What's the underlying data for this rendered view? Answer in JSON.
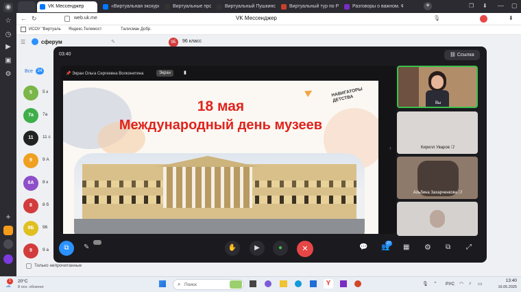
{
  "browser": {
    "tabs": [
      {
        "label": "VK Мессенджер",
        "color": "#0077ff",
        "active": true
      },
      {
        "label": "«Виртуальная экскурс",
        "color": "#0077ff"
      },
      {
        "label": "Виртуальные прогулки",
        "color": "#333333"
      },
      {
        "label": "Виртуальный Пушкинс",
        "color": "#333333"
      },
      {
        "label": "Виртуальный тур по Ру",
        "color": "#c9412b"
      },
      {
        "label": "Разговоры о важном. Ф",
        "color": "#7a2cc4"
      }
    ],
    "url": "web.uk.me",
    "page_title": "VK Мессенджер",
    "bookmarks": [
      "ИСОУ \"Виртуаль",
      "Яндекс.Телемост",
      "Талисман Добр."
    ]
  },
  "messenger": {
    "app_name": "сферум",
    "filter_all": "Все",
    "filter_count": "24",
    "chat_header": "96 класс",
    "chats": [
      {
        "initial": "5",
        "label": "5 к",
        "color": "#7ab648"
      },
      {
        "initial": "7а",
        "label": "7а",
        "color": "#3fae49"
      },
      {
        "initial": "11",
        "label": "11 с",
        "color": "#222222"
      },
      {
        "initial": "9",
        "label": "9 А",
        "color": "#f0a020"
      },
      {
        "initial": "8А",
        "label": "8 к",
        "color": "#8e4fc9"
      },
      {
        "initial": "8",
        "label": "8 б",
        "color": "#d23c3c"
      },
      {
        "initial": "9Б",
        "label": "96",
        "color": "#e0c020"
      },
      {
        "initial": "9",
        "label": "9 а",
        "color": "#d23c3c"
      }
    ],
    "unread_only": "Только непрочитанные"
  },
  "call": {
    "timer": "03:40",
    "link_label": "Ссылка",
    "screen_owner": "Экран Ольга Сергеевна Волконитина",
    "screen_tag": "Экран",
    "slide": {
      "date": "18 мая",
      "title": "Международный день музеев",
      "logo": "НАВИГАТОРЫ ДЕТСТВА"
    },
    "participants": [
      {
        "name": "Вы",
        "active": true
      },
      {
        "name": "Кирилл Уваров"
      },
      {
        "name": "Альбина Захарченкова"
      },
      {
        "name": ""
      }
    ],
    "participants_badge": "27",
    "self_view_badge": "",
    "accent": "#2a91ff",
    "hangup_color": "#e64646"
  },
  "taskbar": {
    "weather_temp": "20°C",
    "weather_desc": "8 осн. облачно",
    "weather_badge": "1",
    "search_label": "Поиск",
    "lang": "РУС",
    "time": "13:40",
    "date": "16.05.2025"
  }
}
